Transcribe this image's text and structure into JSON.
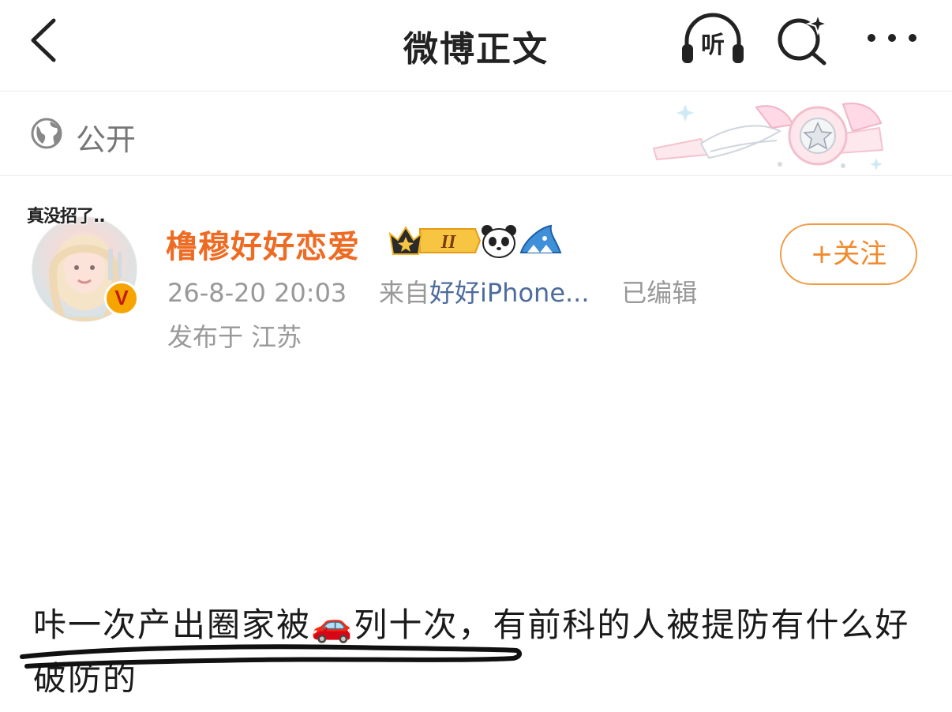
{
  "header": {
    "title": "微博正文",
    "listen_label": "听",
    "icons": [
      "back-icon",
      "listen-icon",
      "search-sparkle-icon",
      "more-icon"
    ]
  },
  "visibility": {
    "label": "公开",
    "icon": "globe-icon"
  },
  "post": {
    "avatar_sticker": "真没招了..",
    "username": "橹穆好好恋爱",
    "badges": [
      "crown-level-badge",
      "panda-badge",
      "shark-badge"
    ],
    "crown_level": "II",
    "verified_mark": "V",
    "time": "26-8-20 20:03",
    "from_label": "来自",
    "source": "好好iPhone...",
    "edited": "已编辑",
    "location": "发布于 江苏",
    "follow_label": "+关注",
    "content_part1": "咔一次产出圈家被",
    "content_emoji": "🚗",
    "content_part2": "列十次，有前科的人被提防有什么好破防的"
  },
  "colors": {
    "username": "#ee6b23",
    "source_link": "#4d6c9c",
    "follow": "#f08a2c",
    "meta": "#999999"
  }
}
